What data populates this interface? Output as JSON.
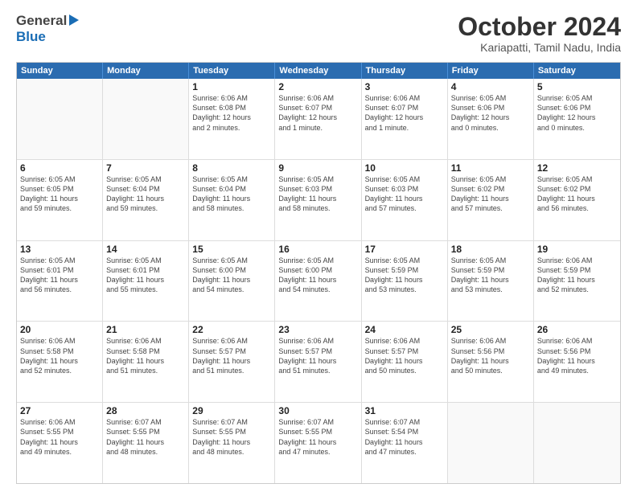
{
  "logo": {
    "general": "General",
    "blue": "Blue"
  },
  "title": "October 2024",
  "subtitle": "Kariapatti, Tamil Nadu, India",
  "days": [
    "Sunday",
    "Monday",
    "Tuesday",
    "Wednesday",
    "Thursday",
    "Friday",
    "Saturday"
  ],
  "weeks": [
    [
      {
        "day": "",
        "info": ""
      },
      {
        "day": "",
        "info": ""
      },
      {
        "day": "1",
        "info": "Sunrise: 6:06 AM\nSunset: 6:08 PM\nDaylight: 12 hours\nand 2 minutes."
      },
      {
        "day": "2",
        "info": "Sunrise: 6:06 AM\nSunset: 6:07 PM\nDaylight: 12 hours\nand 1 minute."
      },
      {
        "day": "3",
        "info": "Sunrise: 6:06 AM\nSunset: 6:07 PM\nDaylight: 12 hours\nand 1 minute."
      },
      {
        "day": "4",
        "info": "Sunrise: 6:05 AM\nSunset: 6:06 PM\nDaylight: 12 hours\nand 0 minutes."
      },
      {
        "day": "5",
        "info": "Sunrise: 6:05 AM\nSunset: 6:06 PM\nDaylight: 12 hours\nand 0 minutes."
      }
    ],
    [
      {
        "day": "6",
        "info": "Sunrise: 6:05 AM\nSunset: 6:05 PM\nDaylight: 11 hours\nand 59 minutes."
      },
      {
        "day": "7",
        "info": "Sunrise: 6:05 AM\nSunset: 6:04 PM\nDaylight: 11 hours\nand 59 minutes."
      },
      {
        "day": "8",
        "info": "Sunrise: 6:05 AM\nSunset: 6:04 PM\nDaylight: 11 hours\nand 58 minutes."
      },
      {
        "day": "9",
        "info": "Sunrise: 6:05 AM\nSunset: 6:03 PM\nDaylight: 11 hours\nand 58 minutes."
      },
      {
        "day": "10",
        "info": "Sunrise: 6:05 AM\nSunset: 6:03 PM\nDaylight: 11 hours\nand 57 minutes."
      },
      {
        "day": "11",
        "info": "Sunrise: 6:05 AM\nSunset: 6:02 PM\nDaylight: 11 hours\nand 57 minutes."
      },
      {
        "day": "12",
        "info": "Sunrise: 6:05 AM\nSunset: 6:02 PM\nDaylight: 11 hours\nand 56 minutes."
      }
    ],
    [
      {
        "day": "13",
        "info": "Sunrise: 6:05 AM\nSunset: 6:01 PM\nDaylight: 11 hours\nand 56 minutes."
      },
      {
        "day": "14",
        "info": "Sunrise: 6:05 AM\nSunset: 6:01 PM\nDaylight: 11 hours\nand 55 minutes."
      },
      {
        "day": "15",
        "info": "Sunrise: 6:05 AM\nSunset: 6:00 PM\nDaylight: 11 hours\nand 54 minutes."
      },
      {
        "day": "16",
        "info": "Sunrise: 6:05 AM\nSunset: 6:00 PM\nDaylight: 11 hours\nand 54 minutes."
      },
      {
        "day": "17",
        "info": "Sunrise: 6:05 AM\nSunset: 5:59 PM\nDaylight: 11 hours\nand 53 minutes."
      },
      {
        "day": "18",
        "info": "Sunrise: 6:05 AM\nSunset: 5:59 PM\nDaylight: 11 hours\nand 53 minutes."
      },
      {
        "day": "19",
        "info": "Sunrise: 6:06 AM\nSunset: 5:59 PM\nDaylight: 11 hours\nand 52 minutes."
      }
    ],
    [
      {
        "day": "20",
        "info": "Sunrise: 6:06 AM\nSunset: 5:58 PM\nDaylight: 11 hours\nand 52 minutes."
      },
      {
        "day": "21",
        "info": "Sunrise: 6:06 AM\nSunset: 5:58 PM\nDaylight: 11 hours\nand 51 minutes."
      },
      {
        "day": "22",
        "info": "Sunrise: 6:06 AM\nSunset: 5:57 PM\nDaylight: 11 hours\nand 51 minutes."
      },
      {
        "day": "23",
        "info": "Sunrise: 6:06 AM\nSunset: 5:57 PM\nDaylight: 11 hours\nand 51 minutes."
      },
      {
        "day": "24",
        "info": "Sunrise: 6:06 AM\nSunset: 5:57 PM\nDaylight: 11 hours\nand 50 minutes."
      },
      {
        "day": "25",
        "info": "Sunrise: 6:06 AM\nSunset: 5:56 PM\nDaylight: 11 hours\nand 50 minutes."
      },
      {
        "day": "26",
        "info": "Sunrise: 6:06 AM\nSunset: 5:56 PM\nDaylight: 11 hours\nand 49 minutes."
      }
    ],
    [
      {
        "day": "27",
        "info": "Sunrise: 6:06 AM\nSunset: 5:55 PM\nDaylight: 11 hours\nand 49 minutes."
      },
      {
        "day": "28",
        "info": "Sunrise: 6:07 AM\nSunset: 5:55 PM\nDaylight: 11 hours\nand 48 minutes."
      },
      {
        "day": "29",
        "info": "Sunrise: 6:07 AM\nSunset: 5:55 PM\nDaylight: 11 hours\nand 48 minutes."
      },
      {
        "day": "30",
        "info": "Sunrise: 6:07 AM\nSunset: 5:55 PM\nDaylight: 11 hours\nand 47 minutes."
      },
      {
        "day": "31",
        "info": "Sunrise: 6:07 AM\nSunset: 5:54 PM\nDaylight: 11 hours\nand 47 minutes."
      },
      {
        "day": "",
        "info": ""
      },
      {
        "day": "",
        "info": ""
      }
    ]
  ]
}
